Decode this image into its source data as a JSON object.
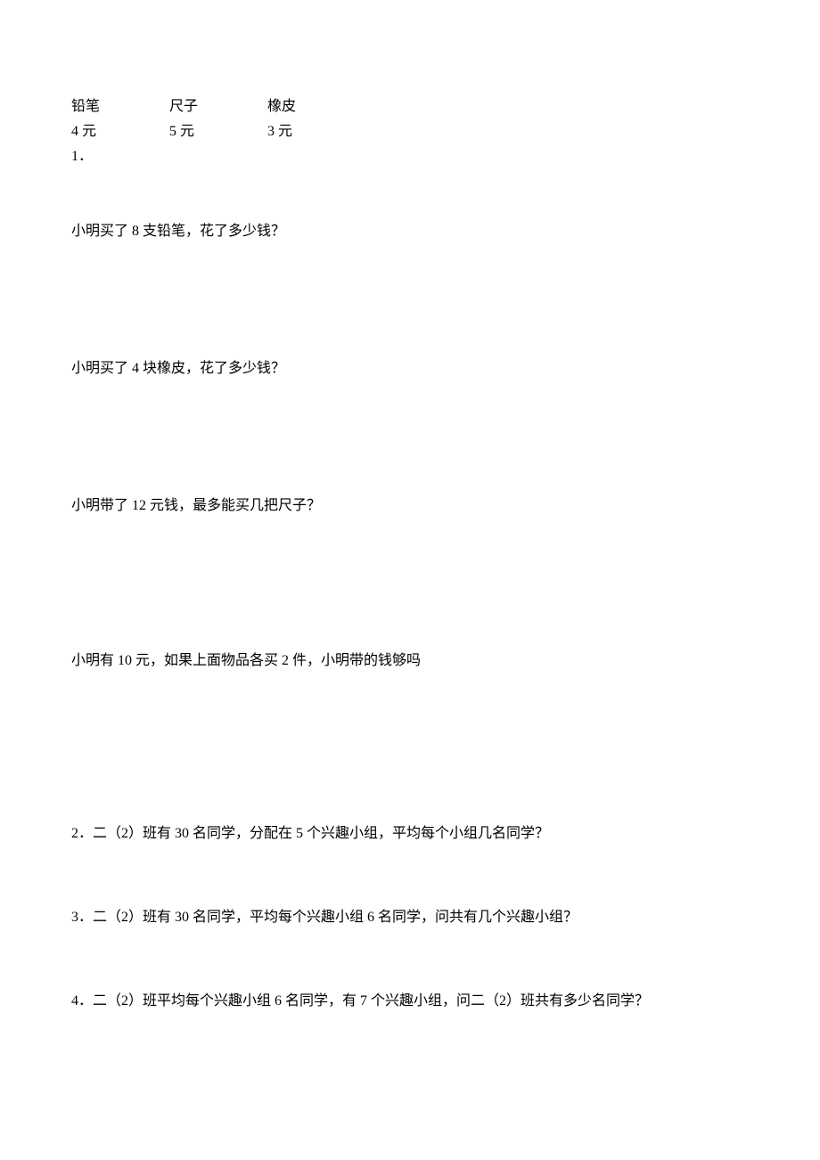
{
  "price_table": {
    "items": [
      {
        "name": "铅笔",
        "price": "4 元"
      },
      {
        "name": "尺子",
        "price": "5 元"
      },
      {
        "name": "橡皮",
        "price": "3 元"
      }
    ]
  },
  "q1": {
    "number_label": "1．",
    "sub": [
      "小明买了 8 支铅笔，花了多少钱？",
      "小明买了 4 块橡皮，花了多少钱？",
      "小明带了 12 元钱，最多能买几把尺子？",
      "小明有 10 元，如果上面物品各买 2 件，小明带的钱够吗"
    ]
  },
  "q2": "2．二（2）班有 30 名同学，分配在 5 个兴趣小组，平均每个小组几名同学？",
  "q3": "3．二（2）班有 30 名同学，平均每个兴趣小组 6 名同学，问共有几个兴趣小组？",
  "q4": "4．二（2）班平均每个兴趣小组 6 名同学，有 7 个兴趣小组，问二（2）班共有多少名同学？"
}
